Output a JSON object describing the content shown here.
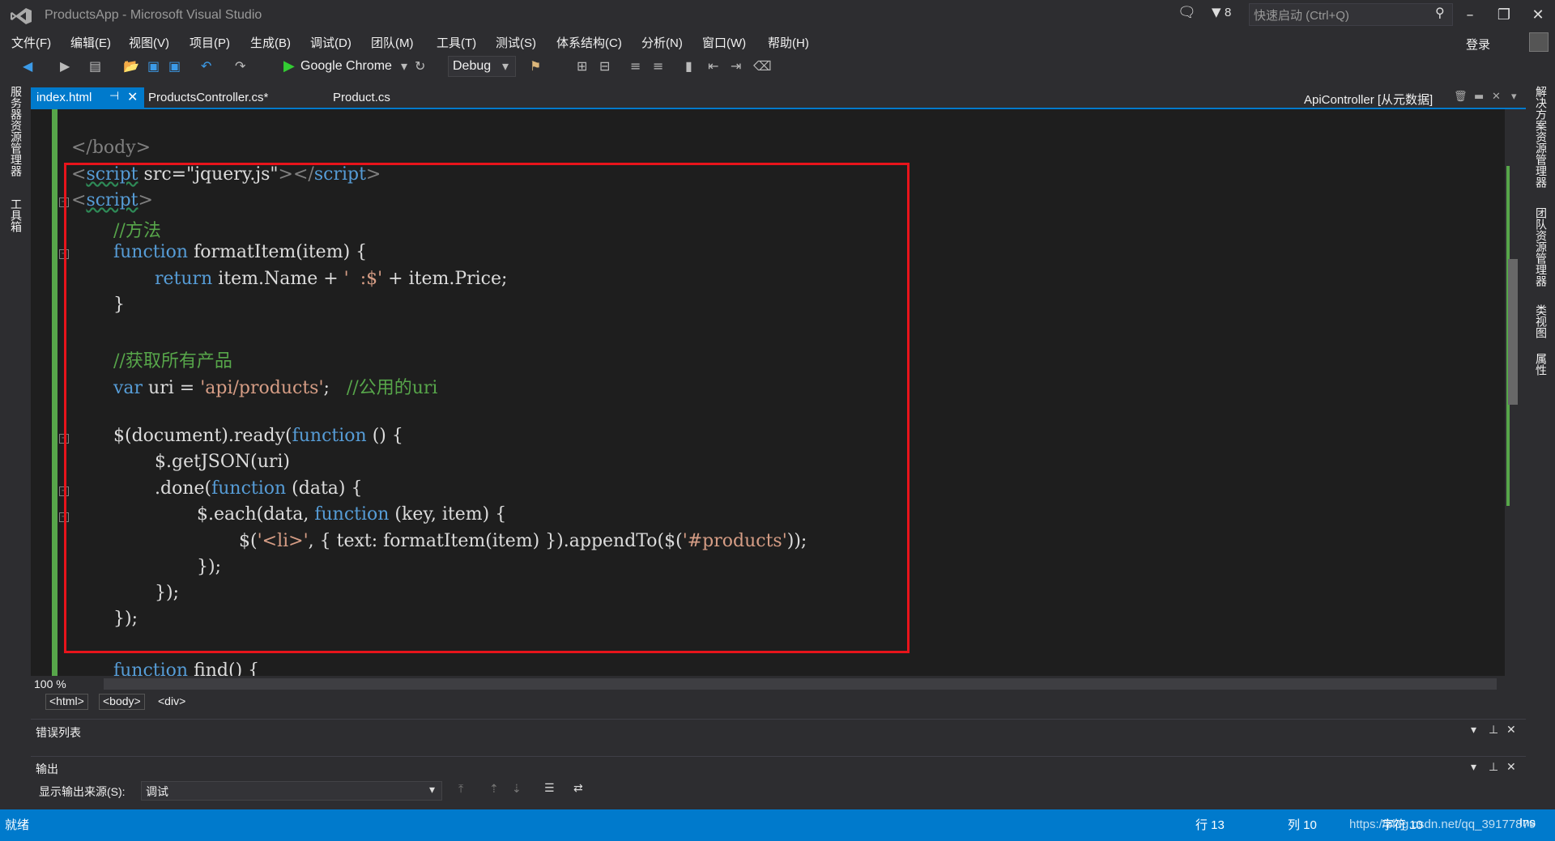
{
  "window": {
    "title": "ProductsApp - Microsoft Visual Studio",
    "quick_launch_placeholder": "快速启动 (Ctrl+Q)",
    "notification_count": "8",
    "login": "登录"
  },
  "menu": [
    "文件(F)",
    "编辑(E)",
    "视图(V)",
    "项目(P)",
    "生成(B)",
    "调试(D)",
    "团队(M)",
    "工具(T)",
    "测试(S)",
    "体系结构(C)",
    "分析(N)",
    "窗口(W)",
    "帮助(H)"
  ],
  "toolbar": {
    "run_target": "Google Chrome",
    "configuration": "Debug"
  },
  "left_sidebar": [
    "服务器资源管理器",
    "工具箱"
  ],
  "right_sidebar": [
    "解决方案资源管理器",
    "团队资源管理器",
    "类视图",
    "属性"
  ],
  "tabs": [
    {
      "label": "index.html",
      "active": true
    },
    {
      "label": "ProductsController.cs*",
      "active": false
    },
    {
      "label": "Product.cs",
      "active": false
    }
  ],
  "preview_tab": "ApiController [从元数据]",
  "editor": {
    "zoom": "100 %",
    "breadcrumbs": [
      "<html>",
      "<body>",
      "<div>"
    ],
    "lines": {
      "l1": "</body>",
      "l2a": "<",
      "l2b": "script",
      "l2c": " src=\"jquery.js\"",
      "l2d": "></",
      "l2e": "script",
      "l2f": ">",
      "l3a": "<",
      "l3b": "script",
      "l3c": ">",
      "l4": "//方法",
      "l5a": "function",
      "l5b": " formatItem(item) {",
      "l6a": "return",
      "l6b": " item.Name + ",
      "l6c": "'  :$'",
      "l6d": " + item.Price;",
      "l7": "}",
      "l9": "//获取所有产品",
      "l10a": "var",
      "l10b": " uri = ",
      "l10c": "'api/products'",
      "l10d": ";   ",
      "l10e": "//公用的uri",
      "l12a": "$(document).ready(",
      "l12b": "function",
      "l12c": " () {",
      "l13": "$.getJSON(uri)",
      "l14a": ".done(",
      "l14b": "function",
      "l14c": " (data) {",
      "l15a": "$.each(data, ",
      "l15b": "function",
      "l15c": " (key, item) {",
      "l16a": "$(",
      "l16b": "'<li>'",
      "l16c": ", { text: formatItem(item) }).appendTo($(",
      "l16d": "'#products'",
      "l16e": "));",
      "l17": "});",
      "l18": "});",
      "l19": "});",
      "l21a": "function",
      "l21b": " find() {"
    }
  },
  "panels": {
    "error_list": "错误列表",
    "output": "输出",
    "output_source_label": "显示输出来源(S):",
    "output_source_value": "调试"
  },
  "status": {
    "ready": "就绪",
    "line": "行 13",
    "col": "列 10",
    "char": "字符 10",
    "mode": "Ins"
  },
  "watermark": "https://blog.csdn.net/qq_39177879",
  "colors": {
    "accent": "#007acc",
    "highlight_box": "#e8141b",
    "keyword": "#569cd6",
    "comment": "#57a64a",
    "string": "#d69d85"
  }
}
